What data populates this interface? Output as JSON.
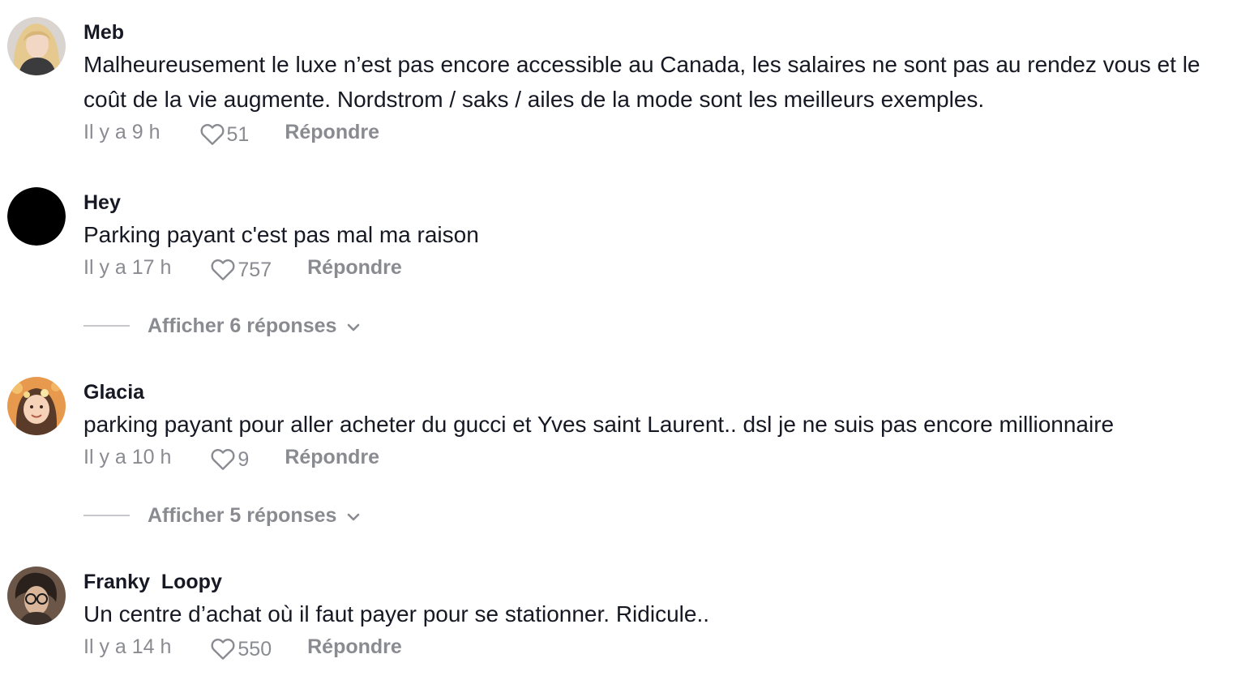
{
  "comments": [
    {
      "username": "Meb",
      "text": "Malheureusement le luxe n’est pas encore accessible au Canada, les salaires ne sont pas au rendez vous et le coût de la vie augmente. Nordstrom / saks / ailes de la mode sont les meilleurs exemples.",
      "time": "Il y a 9 h",
      "likes": "51",
      "reply_label": "Répondre"
    },
    {
      "username": "Hey",
      "text": "Parking payant c'est pas mal ma raison",
      "time": "Il y a 17 h",
      "likes": "757",
      "reply_label": "Répondre",
      "view_replies": "Afficher 6 réponses"
    },
    {
      "username": "Glacia",
      "text": "parking payant pour aller acheter du gucci et Yves saint Laurent.. dsl je ne suis pas encore millionnaire",
      "time": "Il y a 10 h",
      "likes": "9",
      "reply_label": "Répondre",
      "view_replies": "Afficher 5 réponses"
    },
    {
      "username": "Franky  Loopy",
      "text": "Un centre d’achat où il faut payer pour se stationner. Ridicule..",
      "time": "Il y a 14 h",
      "likes": "550",
      "reply_label": "Répondre"
    }
  ],
  "icons": {
    "like": "heart-outline-icon",
    "expand": "chevron-down-icon"
  },
  "colors": {
    "primary_text": "#161823",
    "secondary_text": "#8a8b91",
    "divider": "#c8c8cc",
    "background": "#ffffff"
  }
}
